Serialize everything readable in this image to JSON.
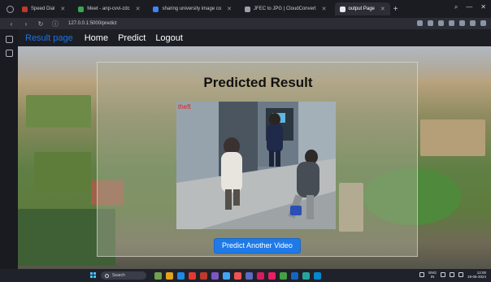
{
  "browser": {
    "tabs": [
      {
        "label": "Speed Dial",
        "active": false
      },
      {
        "label": "Meet - anp-cvvi-zdc",
        "active": false
      },
      {
        "label": "sharing university image co",
        "active": false
      },
      {
        "label": "JFEC to JPG | CloudConvert",
        "active": false
      },
      {
        "label": "output Page",
        "active": true
      }
    ],
    "new_tab": "+",
    "url": "127.0.0.1:5000/predict"
  },
  "site_nav": {
    "brand": "Result page",
    "links": [
      "Home",
      "Predict",
      "Logout"
    ],
    "brand_color": "#1a73e8"
  },
  "result": {
    "title": "Predicted Result",
    "overlay_label": "theft",
    "overlay_color": "#e11d1d",
    "button": "Predict Another Video",
    "button_color": "#1f7ae8"
  },
  "taskbar": {
    "search_placeholder": "Search",
    "lang_line1": "ENG",
    "lang_line2": "IN",
    "time": "12:00",
    "date": "19-06-2024"
  }
}
